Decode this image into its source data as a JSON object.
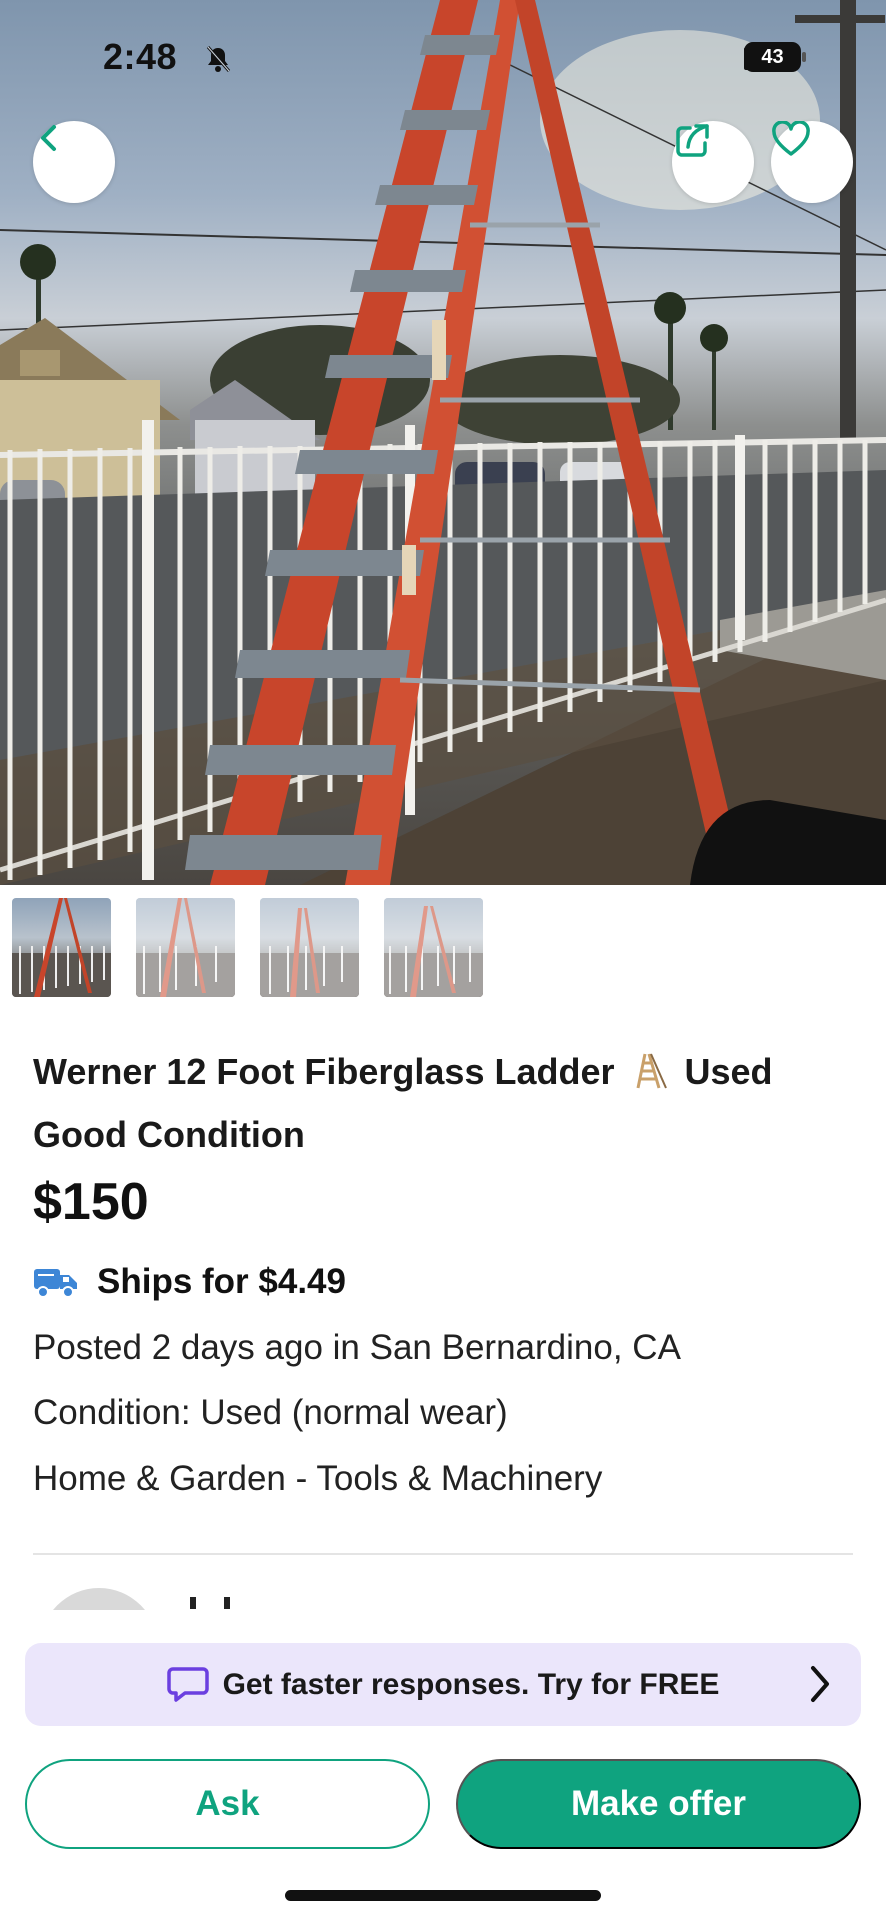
{
  "status_bar": {
    "time": "2:48",
    "battery": "43",
    "icons": [
      "bell-slash-icon",
      "signal-icon",
      "wifi-icon",
      "battery-icon"
    ]
  },
  "header_actions": {
    "back_icon": "chevron-left-icon",
    "share_icon": "share-icon",
    "favorite_icon": "heart-outline-icon"
  },
  "gallery": {
    "thumbnail_count": 4,
    "selected_index": 0
  },
  "listing": {
    "title_part1": "Werner  12 Foot Fiberglass Ladder",
    "title_emoji": "ladder-icon",
    "title_part2": "Used Good Condition",
    "price": "$150",
    "shipping": "Ships for $4.49",
    "posted": "Posted 2 days ago in San Bernardino, CA",
    "condition": "Condition: Used (normal wear)",
    "category": "Home & Garden - Tools & Machinery"
  },
  "promo": {
    "text": "Get faster responses.  Try for FREE",
    "icon": "chat-bubble-icon"
  },
  "actions": {
    "ask_label": "Ask",
    "offer_label": "Make offer"
  },
  "colors": {
    "brand_green": "#0fa37f",
    "promo_bg": "#ebe6fb",
    "truck_blue": "#3d86d6",
    "promo_purple": "#6b3fe0"
  }
}
